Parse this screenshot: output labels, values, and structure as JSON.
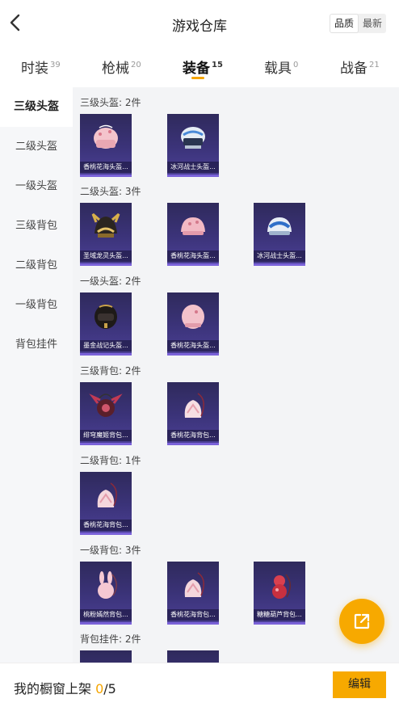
{
  "header": {
    "title": "游戏仓库",
    "sort_quality": "品质",
    "sort_newest": "最新"
  },
  "tabs": [
    {
      "label": "时装",
      "count": "39"
    },
    {
      "label": "枪械",
      "count": "20"
    },
    {
      "label": "装备",
      "count": "15"
    },
    {
      "label": "载具",
      "count": "0"
    },
    {
      "label": "战备",
      "count": "21"
    }
  ],
  "sidebar": [
    "三级头盔",
    "二级头盔",
    "一级头盔",
    "三级背包",
    "二级背包",
    "一级背包",
    "背包挂件"
  ],
  "sections": [
    {
      "title": "三级头盔: 2件",
      "items": [
        "香桃花海头盔...",
        "冰河战士头盔..."
      ]
    },
    {
      "title": "二级头盔: 3件",
      "items": [
        "圣域龙灵头盔...",
        "香桃花海头盔...",
        "冰河战士头盔..."
      ]
    },
    {
      "title": "一级头盔: 2件",
      "items": [
        "墨金战记头盔...",
        "香桃花海头盔..."
      ]
    },
    {
      "title": "三级背包: 2件",
      "items": [
        "绯穹魔姬背包...",
        "香桃花海背包..."
      ]
    },
    {
      "title": "二级背包: 1件",
      "items": [
        "香桃花海背包..."
      ]
    },
    {
      "title": "一级背包: 3件",
      "items": [
        "桃粉嫣然背包...",
        "香桃花海背包...",
        "糖糖葫芦背包..."
      ]
    },
    {
      "title": "背包挂件: 2件",
      "items": [
        "",
        ""
      ]
    }
  ],
  "bottom": {
    "label": "我的橱窗上架 ",
    "current": "0",
    "total": "/5",
    "edit": "编辑"
  },
  "colors": {
    "accent": "#f7a900",
    "card_bg": "#3b3379",
    "card_border": "#7a62d8"
  }
}
